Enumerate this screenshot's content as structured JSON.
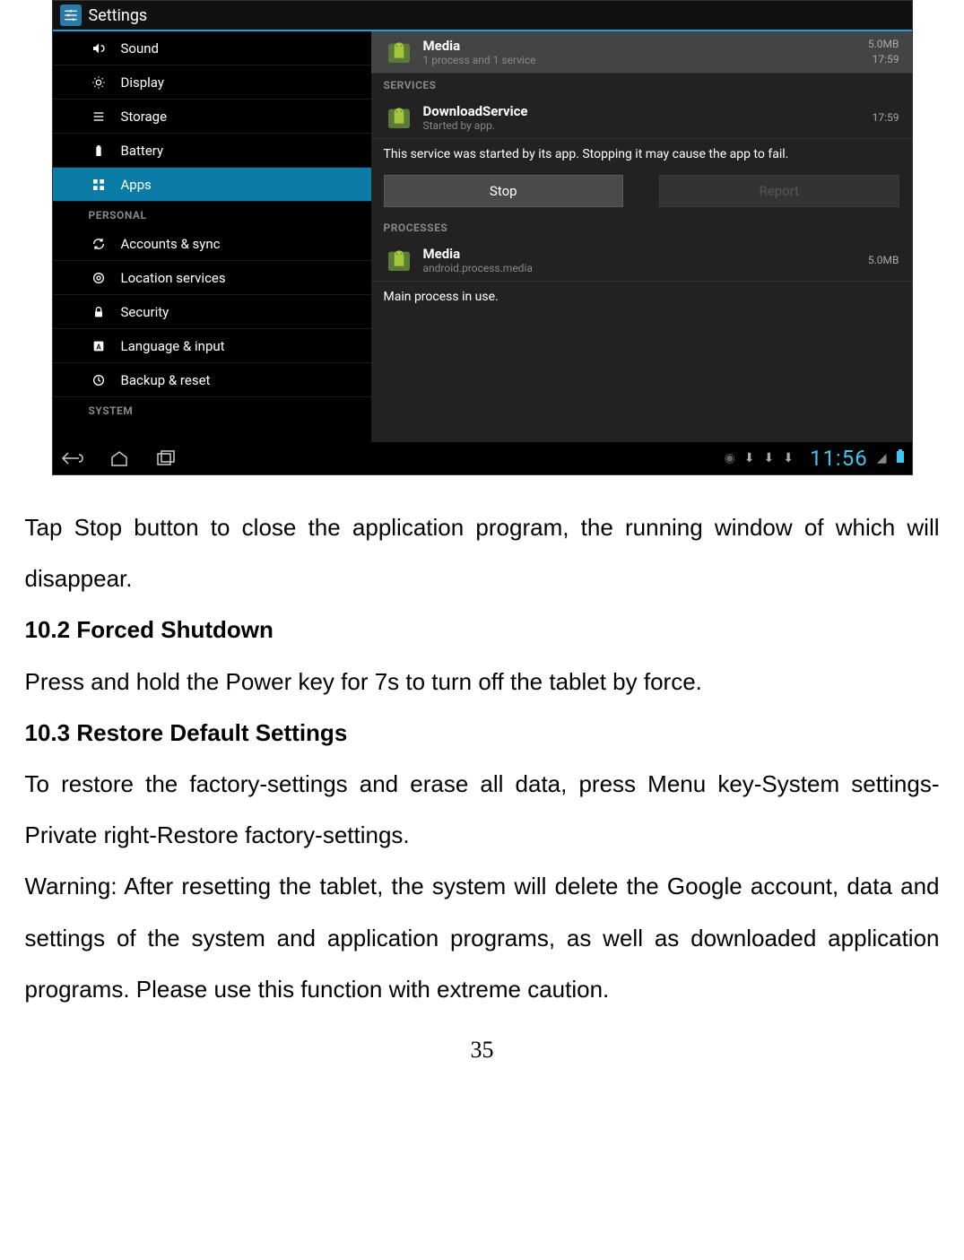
{
  "app_title": "Settings",
  "sidebar": {
    "items_device": [
      {
        "icon": "sound",
        "label": "Sound"
      },
      {
        "icon": "display",
        "label": "Display"
      },
      {
        "icon": "storage",
        "label": "Storage"
      },
      {
        "icon": "battery",
        "label": "Battery"
      },
      {
        "icon": "apps",
        "label": "Apps",
        "active": true
      }
    ],
    "header_personal": "PERSONAL",
    "items_personal": [
      {
        "icon": "sync",
        "label": "Accounts & sync"
      },
      {
        "icon": "location",
        "label": "Location services"
      },
      {
        "icon": "security",
        "label": "Security"
      },
      {
        "icon": "language",
        "label": "Language & input"
      },
      {
        "icon": "backup",
        "label": "Backup & reset"
      }
    ],
    "header_system": "SYSTEM"
  },
  "main": {
    "media_row": {
      "name": "Media",
      "sub": "1 process and 1 service",
      "size": "5.0MB",
      "time": "17:59"
    },
    "hdr_services": "SERVICES",
    "download_row": {
      "name": "DownloadService",
      "sub": "Started by app.",
      "time": "17:59"
    },
    "service_note": "This service was started by its app. Stopping it may cause the app to fail.",
    "btn_stop": "Stop",
    "btn_report": "Report",
    "hdr_processes": "PROCESSES",
    "process_row": {
      "name": "Media",
      "sub": "android.process.media",
      "size": "5.0MB"
    },
    "process_note": "Main process in use."
  },
  "navbar": {
    "time": "11:56"
  },
  "doc": {
    "p1": "Tap Stop button to close the application program, the running window of which will disappear.",
    "h1": "10.2 Forced Shutdown",
    "p2": "Press and hold the Power key for 7s to turn off the tablet by force.",
    "h2": "10.3 Restore Default Settings",
    "p3": "To restore the factory-settings and erase all data, press Menu key-System settings-Private right-Restore factory-settings.",
    "p4": "Warning: After resetting the tablet, the system will delete the Google account, data and settings of the system and application programs, as well as downloaded application programs. Please use this function with extreme caution.",
    "page": "35"
  }
}
